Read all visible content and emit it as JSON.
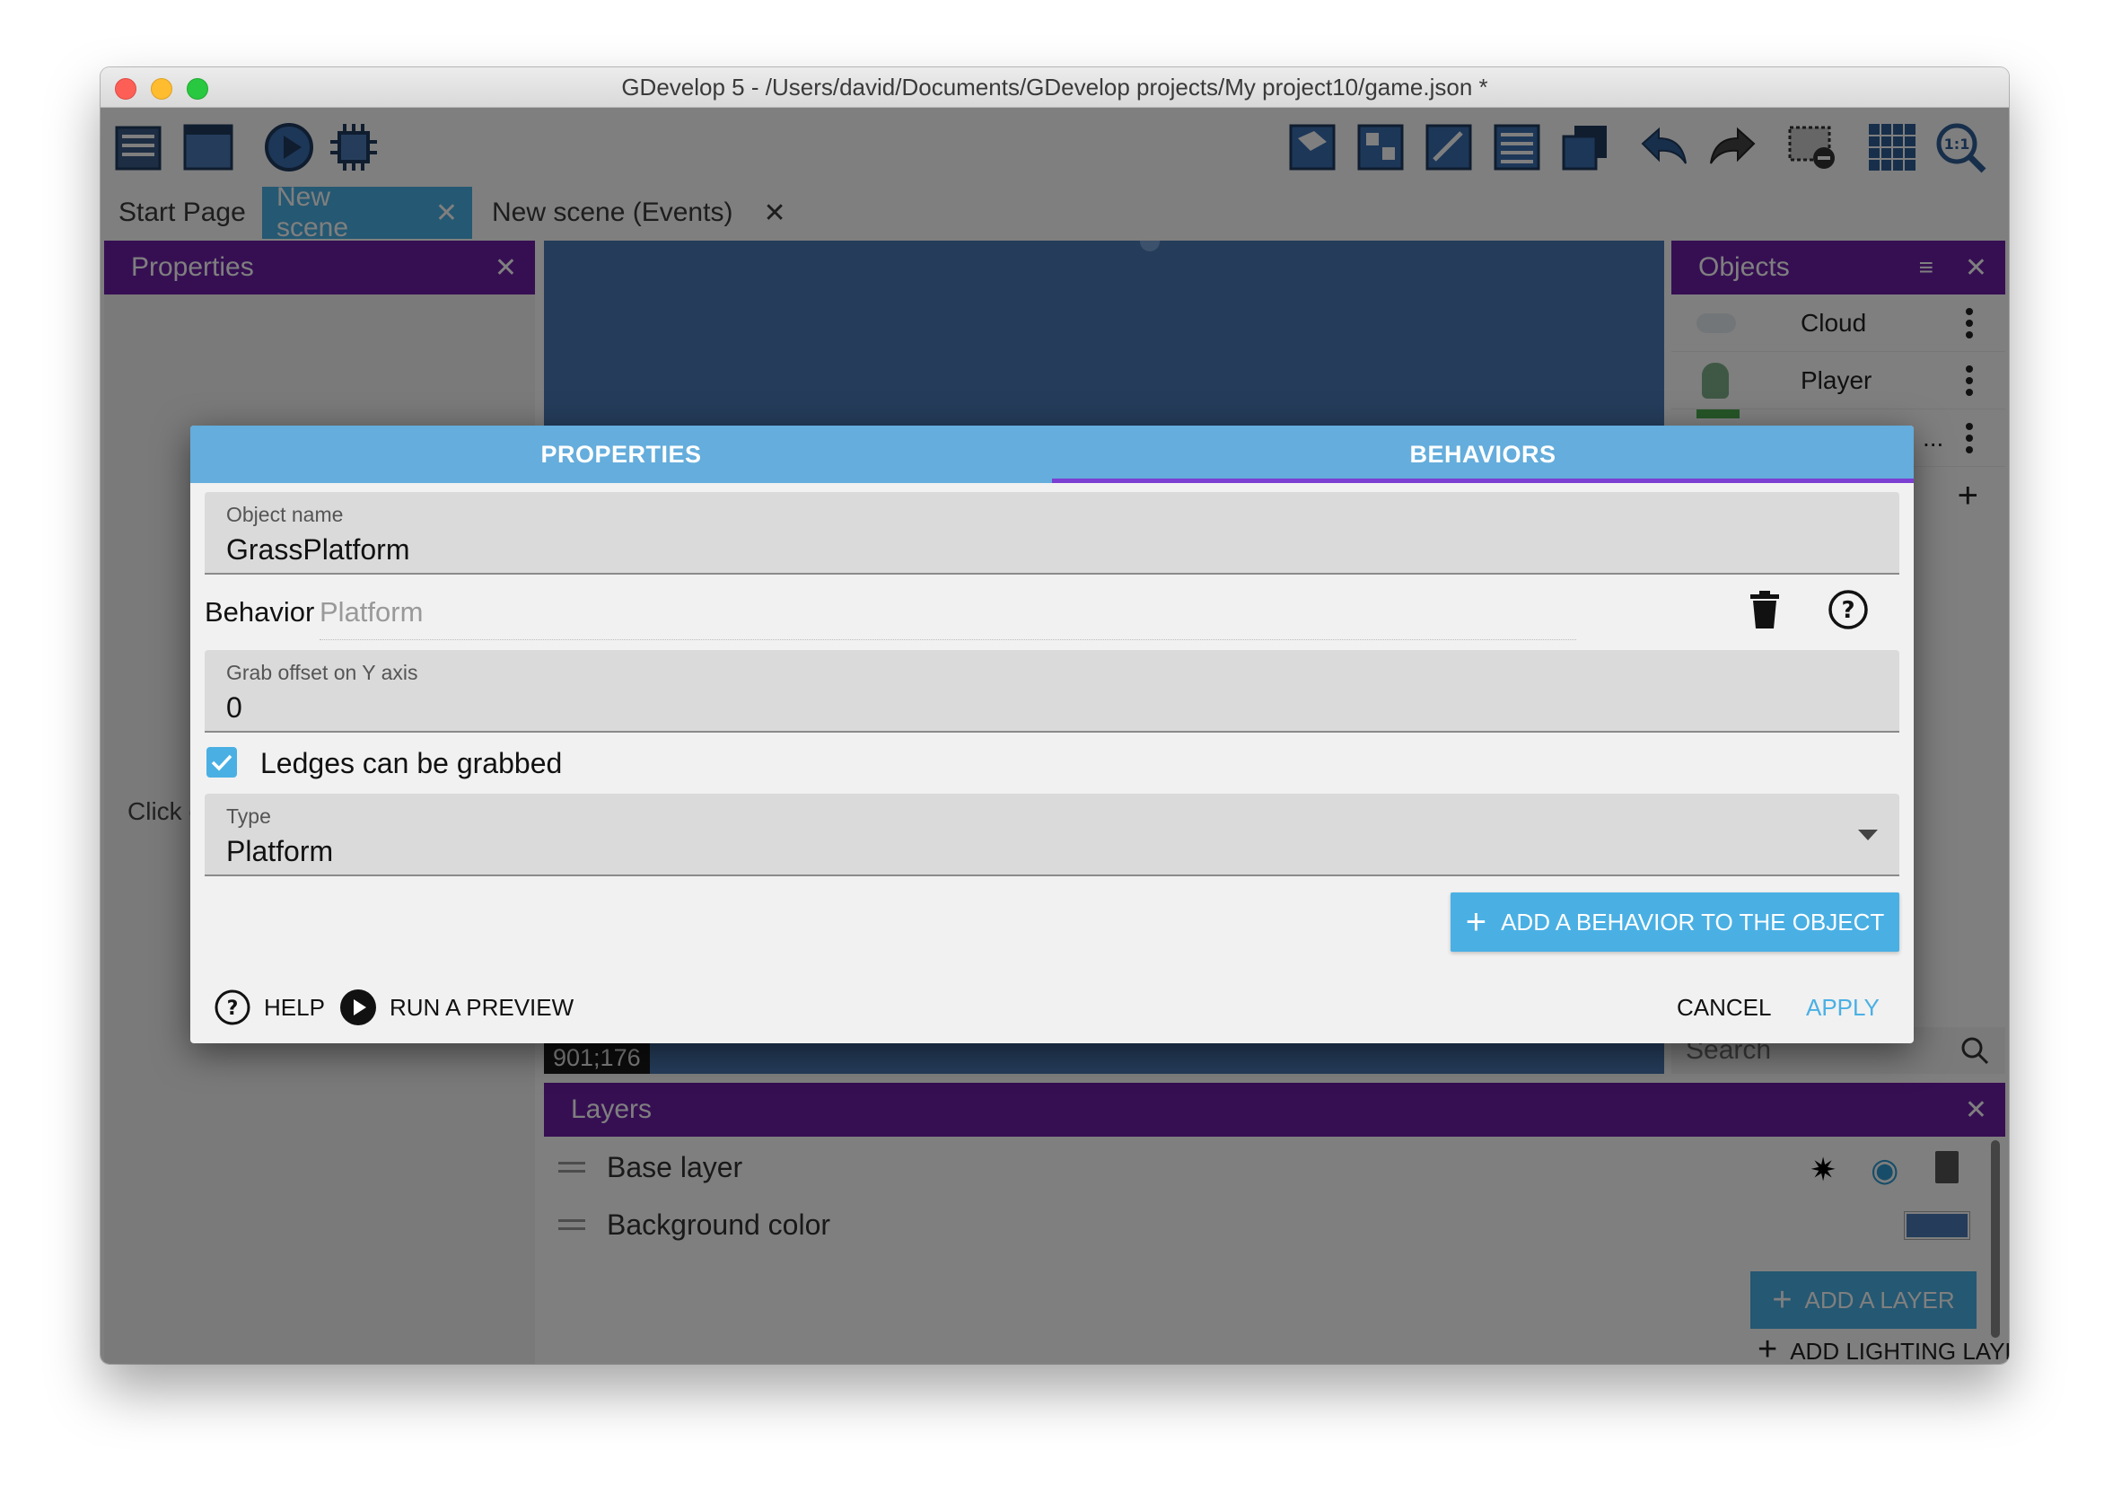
{
  "window": {
    "title": "GDevelop 5 - /Users/david/Documents/GDevelop projects/My project10/game.json *"
  },
  "toolbar": {
    "left_icons": [
      "project-manager-icon",
      "scene-icon",
      "preview-icon",
      "debugger-icon"
    ],
    "right_icons": [
      "objects-panel-icon",
      "object-groups-icon",
      "properties-panel-icon",
      "instances-list-icon",
      "layers-panel-icon",
      "undo-icon",
      "redo-icon",
      "window-mask-icon",
      "grid-icon",
      "zoom-icon"
    ]
  },
  "tabs": [
    {
      "label": "Start Page",
      "active": false,
      "closable": false
    },
    {
      "label": "New scene",
      "active": true,
      "closable": true
    },
    {
      "label": "New scene (Events)",
      "active": false,
      "closable": true
    }
  ],
  "properties_panel": {
    "title": "Properties",
    "hint": "Click o"
  },
  "objects_panel": {
    "title": "Objects",
    "items": [
      {
        "name": "Cloud"
      },
      {
        "name": "Player"
      },
      {
        "name": "..."
      }
    ],
    "search_placeholder": "Search"
  },
  "canvas": {
    "coords": "901;176"
  },
  "layers_panel": {
    "title": "Layers",
    "rows": [
      {
        "label": "Base layer"
      },
      {
        "label": "Background color"
      }
    ],
    "bg_swatch_color": "#4a7ab7",
    "add_layer_label": "ADD A LAYER",
    "add_lighting_label": "ADD LIGHTING LAYER"
  },
  "dialog": {
    "tabs": [
      {
        "label": "PROPERTIES",
        "active": false
      },
      {
        "label": "BEHAVIORS",
        "active": true
      }
    ],
    "object_name": {
      "label": "Object name",
      "value": "GrassPlatform"
    },
    "behavior": {
      "label": "Behavior",
      "name": "Platform"
    },
    "grab_offset": {
      "label": "Grab offset on Y axis",
      "value": "0"
    },
    "ledges": {
      "label": "Ledges can be grabbed",
      "checked": true
    },
    "type": {
      "label": "Type",
      "value": "Platform"
    },
    "add_behavior_label": "ADD A BEHAVIOR TO THE OBJECT",
    "help_label": "HELP",
    "preview_label": "RUN A PREVIEW",
    "cancel_label": "CANCEL",
    "apply_label": "APPLY"
  },
  "colors": {
    "accent": "#4ab0e4",
    "panel_header": "#6c1fa6",
    "dialog_tab_bar": "#64addc",
    "tab_indicator": "#7b3fd1",
    "canvas_bg": "#4a7ab7"
  }
}
